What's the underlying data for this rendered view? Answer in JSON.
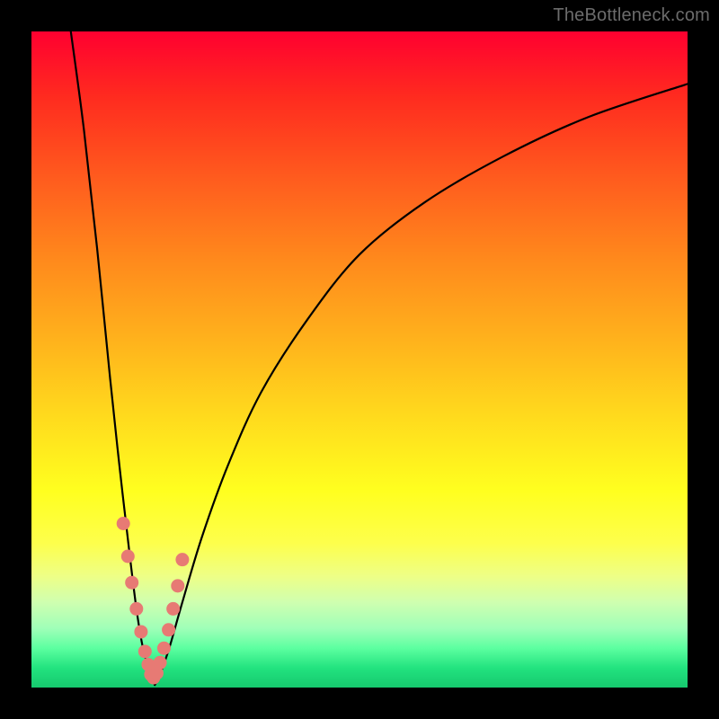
{
  "watermark": "TheBottleneck.com",
  "colors": {
    "gradient_top": "#ff0030",
    "gradient_bottom": "#16c96e",
    "curve": "#000000",
    "dots": "#e77a74",
    "frame": "#000000"
  },
  "chart_data": {
    "type": "line",
    "title": "",
    "xlabel": "",
    "ylabel": "",
    "xlim": [
      0,
      100
    ],
    "ylim": [
      0,
      100
    ],
    "series": [
      {
        "name": "left-branch",
        "x": [
          6,
          8,
          10,
          12,
          13.5,
          15,
          16,
          16.8,
          17.5,
          18,
          18.4,
          18.8
        ],
        "y": [
          100,
          85,
          67,
          47,
          33,
          20,
          12,
          7,
          4,
          2.2,
          1.2,
          0.4
        ]
      },
      {
        "name": "right-branch",
        "x": [
          18.8,
          19.6,
          21,
          23,
          26,
          30,
          35,
          42,
          50,
          60,
          72,
          85,
          100
        ],
        "y": [
          0.4,
          2,
          6,
          13,
          23,
          34,
          45,
          56,
          66,
          74,
          81,
          87,
          92
        ]
      }
    ],
    "markers": {
      "name": "dots",
      "x": [
        14.0,
        14.7,
        15.3,
        16.0,
        16.7,
        17.3,
        17.8,
        18.2,
        18.6,
        19.1,
        19.6,
        20.2,
        20.9,
        21.6,
        22.3,
        23.0
      ],
      "y": [
        25,
        20,
        16,
        12,
        8.5,
        5.5,
        3.5,
        2.0,
        1.5,
        2.2,
        3.8,
        6.0,
        8.8,
        12.0,
        15.5,
        19.5
      ]
    }
  }
}
